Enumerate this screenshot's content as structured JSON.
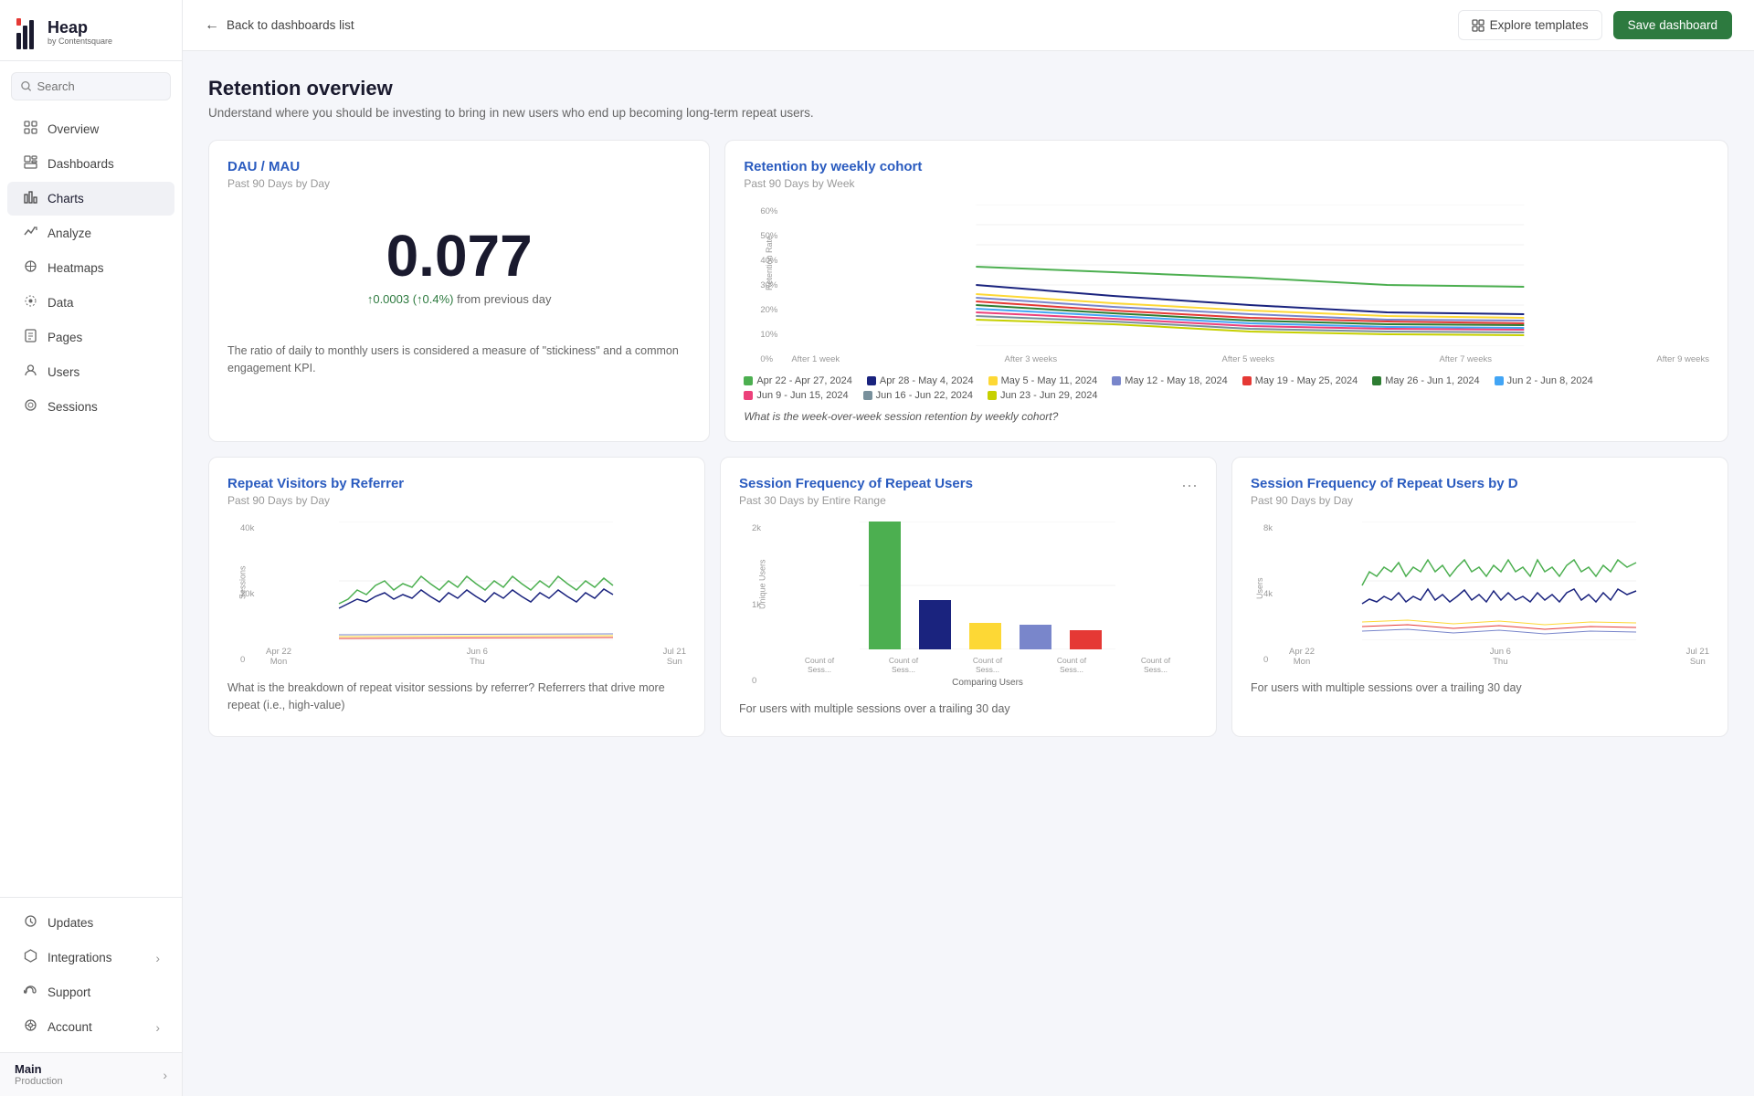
{
  "logo": {
    "heap": "Heap",
    "by": "by Contentsquare"
  },
  "search": {
    "placeholder": "Search"
  },
  "nav": {
    "items": [
      {
        "id": "overview",
        "label": "Overview",
        "icon": "⌂"
      },
      {
        "id": "dashboards",
        "label": "Dashboards",
        "icon": "▦"
      },
      {
        "id": "charts",
        "label": "Charts",
        "icon": "▣"
      },
      {
        "id": "analyze",
        "label": "Analyze",
        "icon": "📈"
      },
      {
        "id": "heatmaps",
        "label": "Heatmaps",
        "icon": "⊞"
      },
      {
        "id": "data",
        "label": "Data",
        "icon": "✦"
      },
      {
        "id": "pages",
        "label": "Pages",
        "icon": "☰"
      },
      {
        "id": "users",
        "label": "Users",
        "icon": "👤"
      },
      {
        "id": "sessions",
        "label": "Sessions",
        "icon": "◎"
      }
    ]
  },
  "bottom_nav": {
    "items": [
      {
        "id": "updates",
        "label": "Updates",
        "icon": "🔔"
      },
      {
        "id": "integrations",
        "label": "Integrations",
        "icon": "⬡",
        "chevron": "›"
      },
      {
        "id": "support",
        "label": "Support",
        "icon": "💬"
      },
      {
        "id": "account",
        "label": "Account",
        "icon": "⚙",
        "chevron": "›"
      }
    ]
  },
  "workspace": {
    "main": "Main",
    "sub": "Production"
  },
  "topbar": {
    "back_label": "Back to dashboards list",
    "explore_label": "Explore templates",
    "save_label": "Save dashboard"
  },
  "page": {
    "title": "Retention overview",
    "subtitle": "Understand where you should be investing to bring in new users who end up becoming long-term repeat users."
  },
  "dau_mau": {
    "title": "DAU / MAU",
    "subtitle": "Past 90 Days by Day",
    "value": "0.077",
    "change_value": "↑0.0003 (↑0.4%)",
    "change_text": " from previous day",
    "description": "The ratio of daily to monthly users is considered a measure of \"stickiness\" and a common engagement KPI."
  },
  "retention_cohort": {
    "title": "Retention by weekly cohort",
    "subtitle": "Past 90 Days by Week",
    "y_label": "Retention Rate",
    "x_labels": [
      "After 1 week",
      "After 3 weeks",
      "After 5 weeks",
      "After 7 weeks",
      "After 9 weeks"
    ],
    "y_ticks": [
      "60%",
      "50%",
      "40%",
      "30%",
      "20%",
      "10%",
      "0%"
    ],
    "legend": [
      {
        "color": "#4caf50",
        "label": "Apr 22 - Apr 27, 2024"
      },
      {
        "color": "#1a237e",
        "label": "Apr 28 - May 4, 2024"
      },
      {
        "color": "#fdd835",
        "label": "May 5 - May 11, 2024"
      },
      {
        "color": "#7986cb",
        "label": "May 12 - May 18, 2024"
      },
      {
        "color": "#e53935",
        "label": "May 19 - May 25, 2024"
      },
      {
        "color": "#2e7d32",
        "label": "May 26 - Jun 1, 2024"
      },
      {
        "color": "#42a5f5",
        "label": "Jun 2 - Jun 8, 2024"
      },
      {
        "color": "#ec407a",
        "label": "Jun 9 - Jun 15, 2024"
      },
      {
        "color": "#78909c",
        "label": "Jun 16 - Jun 22, 2024"
      },
      {
        "color": "#c6d000",
        "label": "Jun 23 - Jun 29, 2024"
      }
    ],
    "question": "What is the week-over-week session retention by weekly cohort?"
  },
  "repeat_visitors": {
    "title": "Repeat Visitors by Referrer",
    "subtitle": "Past 90 Days by Day",
    "y_ticks": [
      "40k",
      "20k",
      "0"
    ],
    "x_labels": [
      "Apr 22\nMon",
      "Jun 6\nThu",
      "Jul 21\nSun"
    ],
    "y_label": "Sessions",
    "description": "What is the breakdown of repeat visitor sessions by referrer? Referrers that drive more repeat (i.e., high-value)"
  },
  "session_freq": {
    "title": "Session Frequency of Repeat Users",
    "subtitle": "Past 30 Days by Entire Range",
    "y_ticks": [
      "2k",
      "1k",
      "0"
    ],
    "x_label": "Comparing Users",
    "y_label": "Unique Users",
    "bars": [
      {
        "label": "Count of Sess...",
        "value": 2000,
        "color": "#4caf50"
      },
      {
        "label": "Count of Sess...",
        "value": 780,
        "color": "#1a237e"
      },
      {
        "label": "Count of Sess...",
        "value": 420,
        "color": "#fdd835"
      },
      {
        "label": "Count of Sess...",
        "value": 380,
        "color": "#7986cb"
      },
      {
        "label": "Count of Sess...",
        "value": 300,
        "color": "#e53935"
      }
    ],
    "description": "For users with multiple sessions over a trailing 30 day"
  },
  "session_freq_device": {
    "title": "Session Frequency of Repeat Users by D",
    "subtitle": "Past 90 Days by Day",
    "y_ticks": [
      "8k",
      "4k",
      "0"
    ],
    "x_labels": [
      "Apr 22\nMon",
      "Jun 6\nThu",
      "Jul 21\nSun"
    ],
    "y_label": "Users",
    "description": "For users with multiple sessions over a trailing 30 day"
  }
}
